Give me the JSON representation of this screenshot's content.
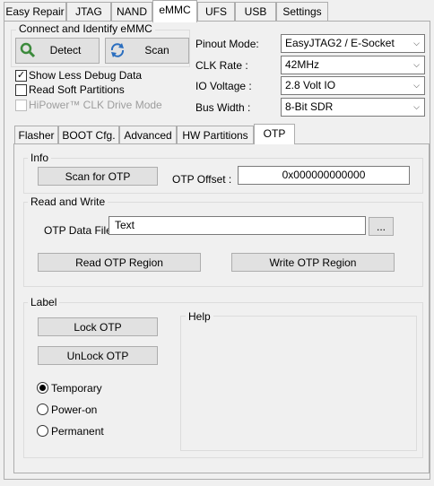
{
  "main_tabs": [
    "Easy Repair",
    "JTAG",
    "NAND",
    "eMMC",
    "UFS",
    "USB",
    "Settings"
  ],
  "main_tab_active": "eMMC",
  "connect": {
    "title": "Connect and Identify eMMC",
    "detect_label": "Detect",
    "scan_label": "Scan",
    "show_less_debug": "Show Less Debug Data",
    "show_less_debug_checked": true,
    "read_soft_partitions": "Read Soft Partitions",
    "read_soft_partitions_checked": false,
    "hipower": "HiPower™ CLK Drive Mode",
    "hipower_enabled": false
  },
  "settings": {
    "pinout_label": "Pinout Mode:",
    "pinout_value": "EasyJTAG2 / E-Socket",
    "clk_label": "CLK Rate :",
    "clk_value": "42MHz",
    "io_label": "IO Voltage :",
    "io_value": "2.8 Volt IO",
    "bus_label": "Bus Width :",
    "bus_value": "8-Bit SDR"
  },
  "sub_tabs": [
    "Flasher",
    "BOOT Cfg.",
    "Advanced",
    "HW Partitions",
    "OTP"
  ],
  "sub_tab_active": "OTP",
  "otp": {
    "info_title": "Info",
    "scan_label": "Scan for OTP",
    "offset_label": "OTP Offset :",
    "offset_value": "0x000000000000",
    "rw_title": "Read and Write",
    "data_file_label": "OTP Data File",
    "data_file_value": "Text",
    "browse_label": "...",
    "read_label": "Read OTP Region",
    "write_label": "Write OTP Region"
  },
  "lock": {
    "label_title": "Label",
    "lock_label": "Lock OTP",
    "unlock_label": "UnLock OTP",
    "help_title": "Help",
    "options": [
      "Temporary",
      "Power-on",
      "Permanent"
    ],
    "selected": "Temporary"
  },
  "colors": {
    "accent_green": "#3c8a3c",
    "accent_blue": "#2a6ebf"
  }
}
